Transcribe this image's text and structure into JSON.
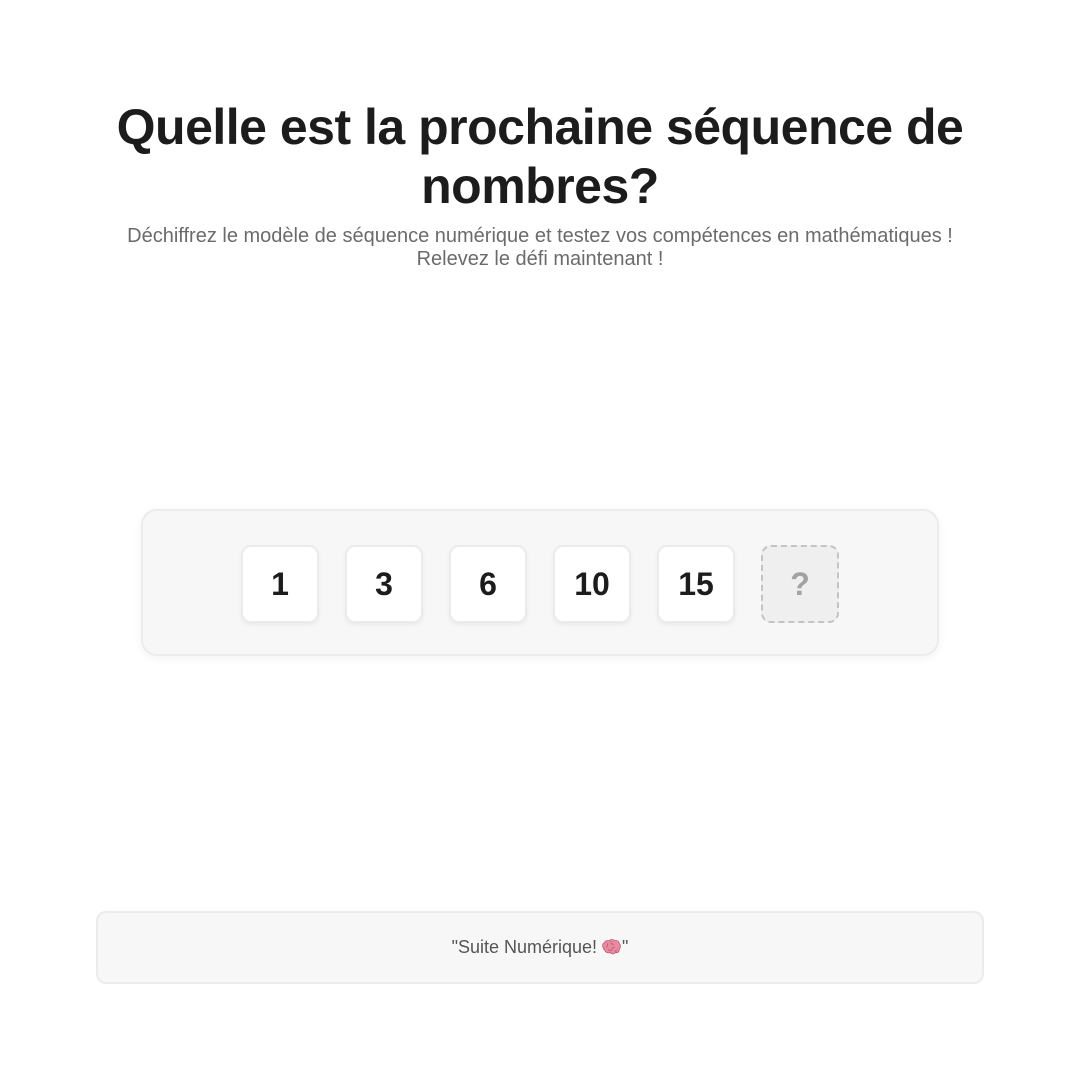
{
  "header": {
    "title": "Quelle est la prochaine séquence de nombres?",
    "subtitle": "Déchiffrez le modèle de séquence numérique et testez vos compétences en mathématiques ! Relevez le défi maintenant !"
  },
  "sequence": {
    "items": [
      "1",
      "3",
      "6",
      "10",
      "15"
    ],
    "unknown": "?"
  },
  "footer": {
    "text_prefix": "\"Suite Numérique! ",
    "icon": "brain-icon",
    "text_suffix": "\""
  },
  "colors": {
    "title": "#1c1c1c",
    "subtitle": "#6b6b6b",
    "panel_bg": "#f7f7f7",
    "tile_bg": "#ffffff",
    "unknown_tile_bg": "#efefef",
    "unknown_text": "#a2a2a2",
    "brain": "#e98aa0"
  }
}
